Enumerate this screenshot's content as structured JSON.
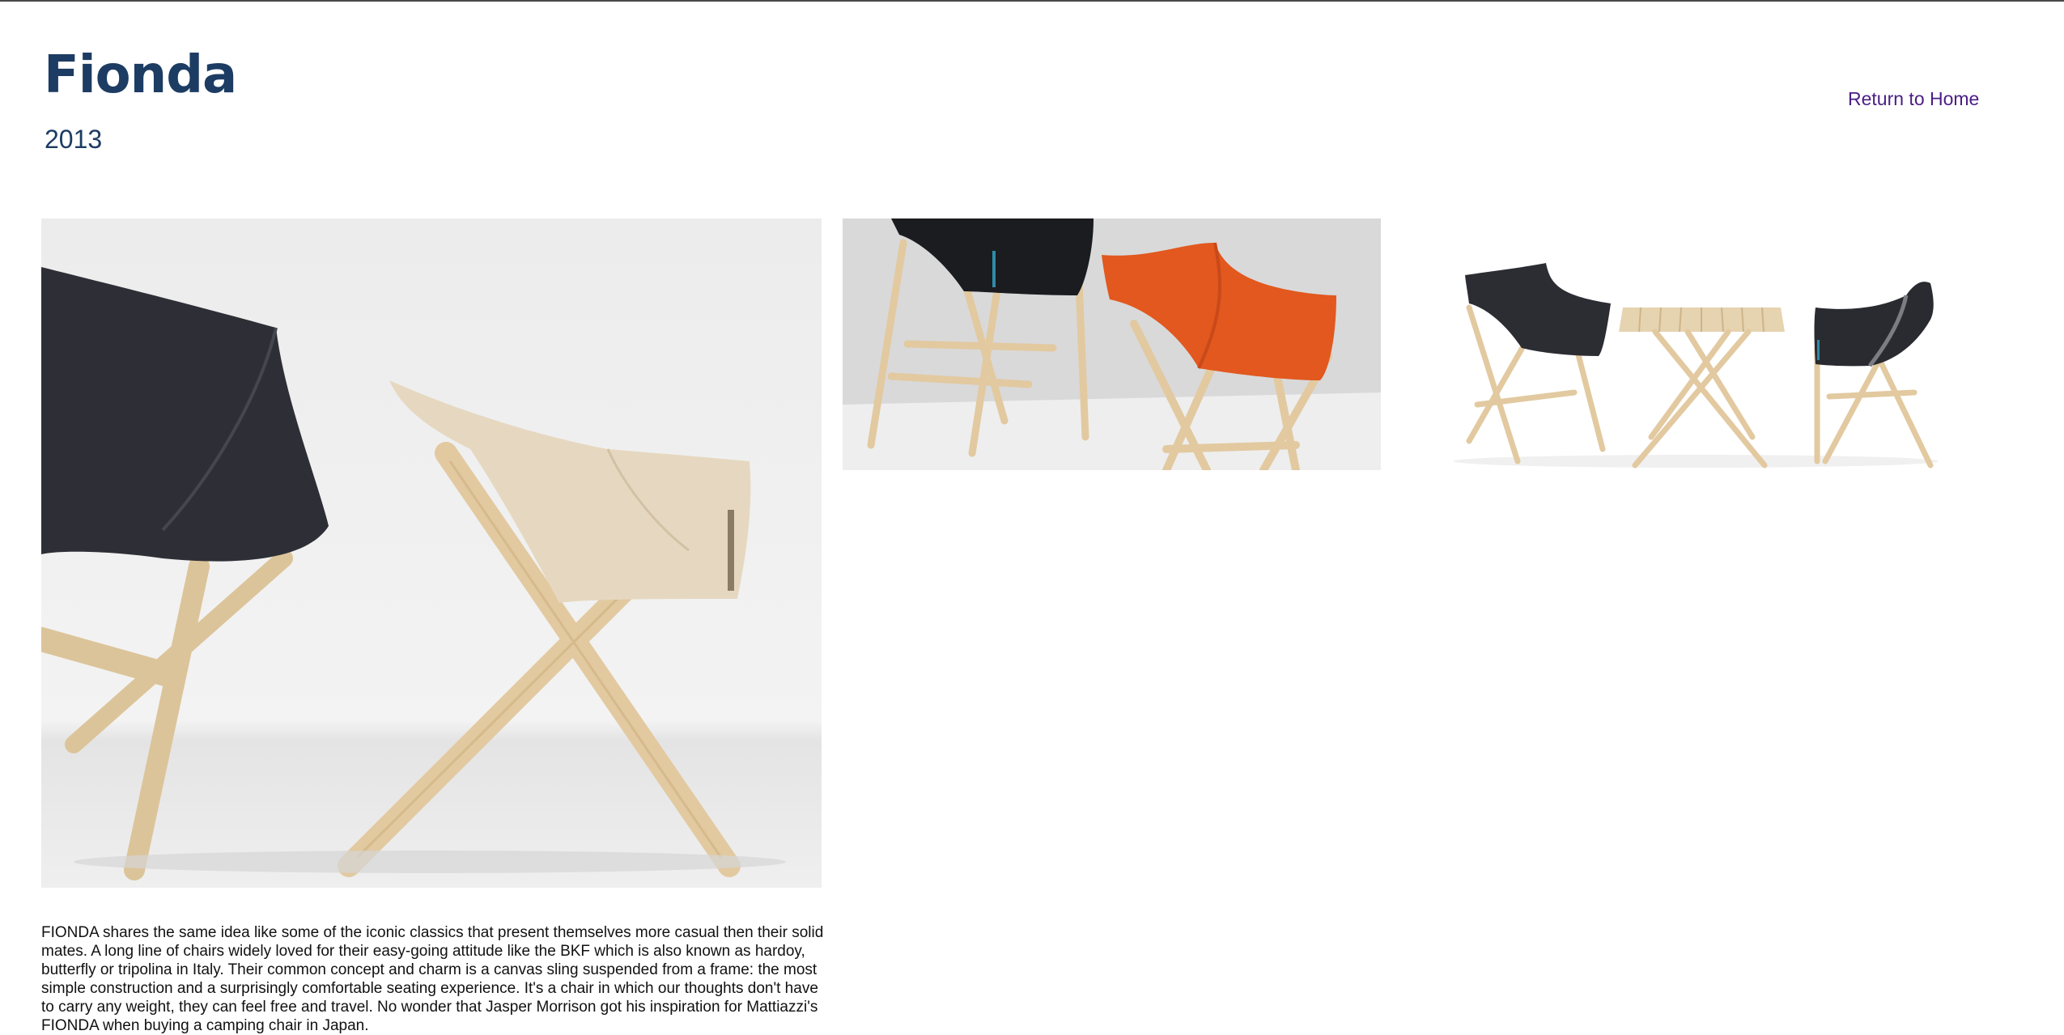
{
  "header": {
    "title": "Fionda",
    "year": "2013",
    "return_link": "Return to Home"
  },
  "gallery": {
    "images": [
      {
        "subject": "canvas-chairs-closeup"
      },
      {
        "subject": "black-and-orange-chairs"
      },
      {
        "subject": "chairs-and-folding-table"
      }
    ]
  },
  "description": "FIONDA shares the same idea like some of the iconic classics that present themselves more casual then their solid mates. A long line of chairs widely loved for their easy-going attitude like the BKF which is also known as hardoy, butterfly or tripolina in Italy. Their common concept and charm is a canvas sling suspended from a frame: the most simple construction and a surprisingly comfortable seating experience. It's a chair in which our thoughts don't have to carry any weight, they can feel free and travel. No wonder that Jasper Morrison got his inspiration for Mattiazzi's FIONDA when buying a camping chair in Japan.",
  "colors": {
    "title": "#1d3c63",
    "link": "#4b1d86",
    "canvas_dark": "#2e2f36",
    "canvas_cream": "#e6d8c0",
    "canvas_orange": "#e2581e",
    "wood": "#e2c9a0"
  }
}
